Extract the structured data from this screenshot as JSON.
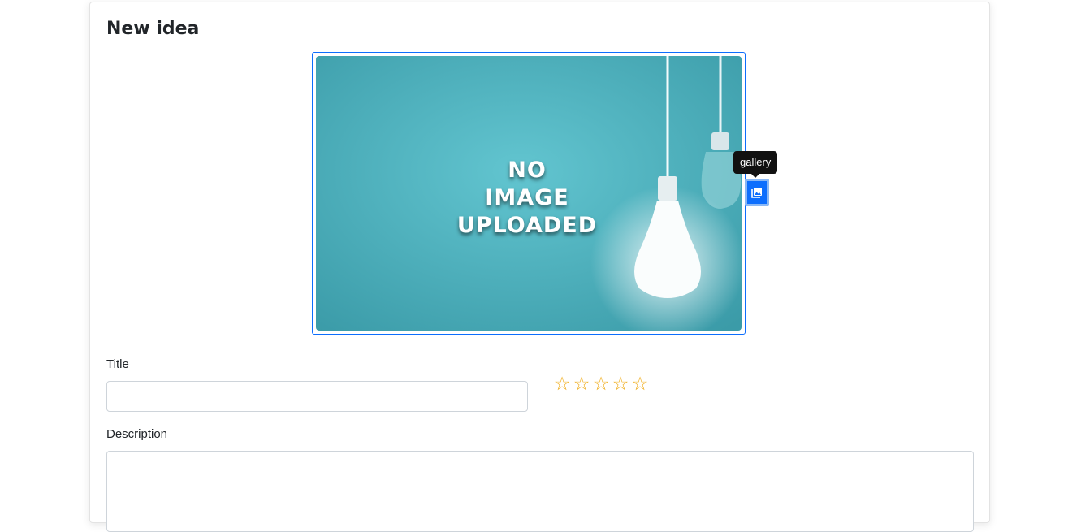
{
  "page": {
    "title": "New idea"
  },
  "image": {
    "placeholder_lines": [
      "NO",
      "IMAGE",
      "UPLOADED"
    ],
    "gallery_tooltip": "gallery",
    "gallery_icon": "image-gallery-icon"
  },
  "form": {
    "title_label": "Title",
    "title_value": "",
    "description_label": "Description",
    "description_value": ""
  },
  "rating": {
    "value": 0,
    "max": 5,
    "empty_star": "☆",
    "filled_star": "★",
    "star_color": "#f0ad1c"
  },
  "colors": {
    "accent": "#0d6efd",
    "tooltip_bg": "#111111",
    "placeholder_bg": "#4fb4c1"
  }
}
